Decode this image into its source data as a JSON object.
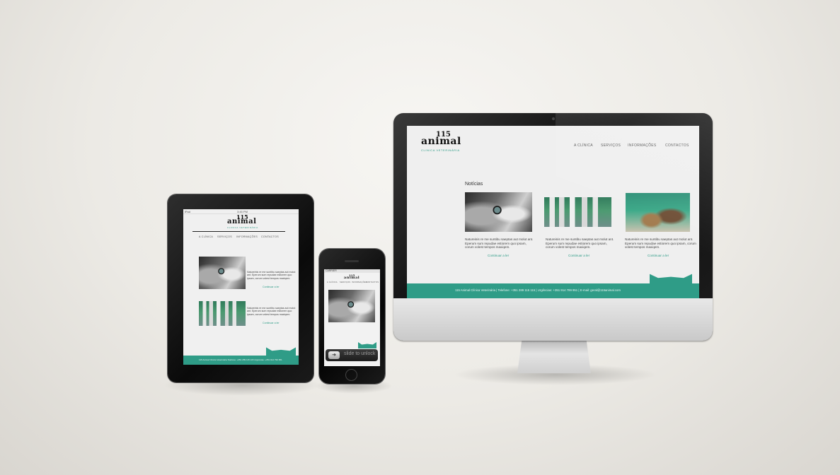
{
  "site": {
    "logo_number": "115",
    "logo_word": "animal",
    "logo_subtitle": "CLINICA VETERINÁRIA",
    "brand_color": "#2f9c87"
  },
  "desktop": {
    "nav": [
      "A CLÍNICA",
      "SERVIÇOS",
      "INFORMAÇÕES",
      "CONTACTOS"
    ],
    "section_title": "Notícias",
    "news": [
      {
        "text": "Natureinis re me suntibu saeptas aut molut ant. Eperum sum repudae estiorem quo ipsam, corum volest tempos maxiqem.",
        "link": "Continuar a ler",
        "image": "cat-photo"
      },
      {
        "text": "Natureinis re me suntibu saeptas aut molut ant. Eperum sum repudae estiorem quo ipsam, corum volest tempos maxiqem.",
        "link": "Continuar a ler",
        "image": "team-photo"
      },
      {
        "text": "Natureinis re me suntibu saeptas aut molut ant. Eperum sum repudae estiorem quo ipsam, corum volest tempos maxiqem.",
        "link": "Continuar a ler",
        "image": "clinic-photo"
      }
    ],
    "footer": "115 Animal Clínica Veterinária | Telefone: +351 289 115 115 | Urgências: +351 914 799 951 | E-mail: geral@115animal.com"
  },
  "tablet": {
    "status_left": "iPad",
    "status_time": "3:45 PM",
    "nav": [
      "A CLÍNICA",
      "SERVIÇOS",
      "INFORMAÇÕES",
      "CONTACTOS"
    ],
    "news": [
      {
        "text": "Natureinis re me suntibu saeptas aut molut ant. Eperum sum repudae estiorem quo ipsam, corum volest tempos maxiqem.",
        "link": "Continuar a ler"
      },
      {
        "text": "Natureinis re me suntibu saeptas aut molut ant. Eperum sum repudae estiorem quo ipsam, corum volest tempos maxiqem.",
        "link": "Continuar a ler"
      }
    ],
    "footer": "115 Animal Clínica Veterinária  Telefone: +351 289 115 115  Urgências: +351 914 799 951"
  },
  "phone": {
    "status_left": "CARRIER",
    "nav": [
      "A CLÍNICA",
      "SERVIÇOS",
      "INFORMAÇÕES",
      "CONTACTOS"
    ],
    "slide_text": "slide to unlock"
  }
}
